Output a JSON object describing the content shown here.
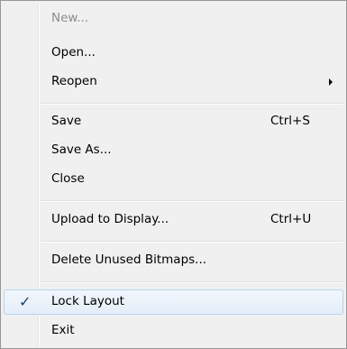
{
  "menu": {
    "new_label": "New...",
    "open_label": "Open...",
    "reopen_label": "Reopen",
    "save_label": "Save",
    "save_shortcut": "Ctrl+S",
    "save_as_label": "Save As...",
    "close_label": "Close",
    "upload_label": "Upload to Display...",
    "upload_shortcut": "Ctrl+U",
    "delete_bitmaps_label": "Delete Unused Bitmaps...",
    "lock_layout_label": "Lock Layout",
    "lock_layout_checked": true,
    "exit_label": "Exit",
    "check_glyph": "✓"
  },
  "icons": {
    "check": "checkmark-icon",
    "submenu": "chevron-right-icon"
  },
  "colors": {
    "menu_background": "#f0f0f0",
    "menu_border": "#979797",
    "disabled_text": "#8d8d8d",
    "highlight_border": "#b7d3ef",
    "check_color": "#1b3f7a"
  }
}
